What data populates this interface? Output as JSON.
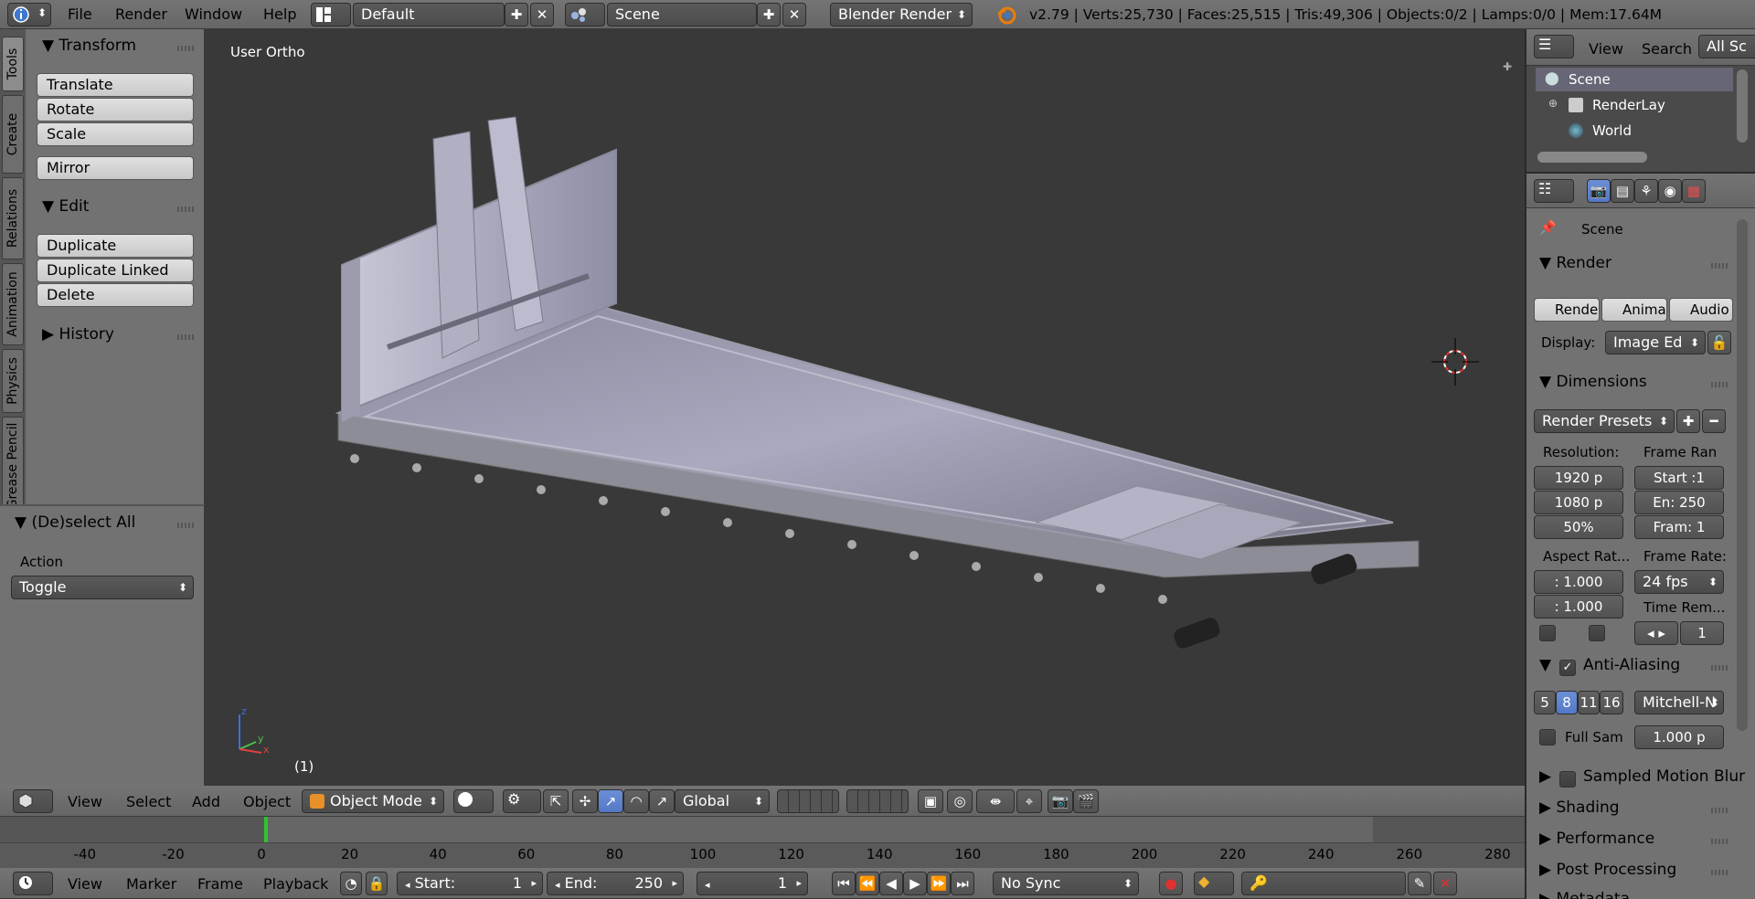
{
  "top": {
    "menus": [
      "File",
      "Render",
      "Window",
      "Help"
    ],
    "screen_layout": "Default",
    "scene": "Scene",
    "engine": "Blender Render",
    "stats": "v2.79 | Verts:25,730 | Faces:25,515 | Tris:49,306 | Objects:0/2 | Lamps:0/0 | Mem:17.64M"
  },
  "tabs": [
    "Tools",
    "Create",
    "Relations",
    "Animation",
    "Physics",
    "Grease Pencil"
  ],
  "toolshelf": {
    "transform_title": "Transform",
    "translate": "Translate",
    "rotate": "Rotate",
    "scale": "Scale",
    "mirror": "Mirror",
    "edit_title": "Edit",
    "duplicate": "Duplicate",
    "duplicate_linked": "Duplicate Linked",
    "delete": "Delete",
    "history_title": "History"
  },
  "operator": {
    "title": "(De)select All",
    "action_label": "Action",
    "action_value": "Toggle"
  },
  "viewport": {
    "view_name": "User Ortho",
    "frame_indicator": "(1)",
    "axis_labels": [
      "z",
      "y",
      "x"
    ]
  },
  "view3d_header": {
    "menus": [
      "View",
      "Select",
      "Add",
      "Object"
    ],
    "mode": "Object Mode",
    "orientation": "Global"
  },
  "timeline": {
    "ticks": [
      "-40",
      "-20",
      "0",
      "20",
      "40",
      "60",
      "80",
      "100",
      "120",
      "140",
      "160",
      "180",
      "200",
      "220",
      "240",
      "260",
      "280"
    ],
    "current_frame": 1,
    "menus": [
      "View",
      "Marker",
      "Frame",
      "Playback"
    ],
    "start_label": "Start:",
    "start_value": "1",
    "end_label": "End:",
    "end_value": "250",
    "frame_value": "1",
    "sync": "No Sync"
  },
  "outliner": {
    "menus": [
      "View",
      "Search"
    ],
    "filter": "All Sc",
    "items": [
      "Scene",
      "RenderLay",
      "World"
    ]
  },
  "properties": {
    "scene_path": "Scene",
    "render_title": "Render",
    "render_btns": [
      "Rende",
      "Anima",
      "Audio"
    ],
    "display_label": "Display:",
    "display_value": "Image Ed",
    "dimensions_title": "Dimensions",
    "presets": "Render Presets",
    "resolution_label": "Resolution:",
    "res_x": "1920 p",
    "res_y": "1080 p",
    "res_pct": "50%",
    "frame_range_label": "Frame Ran",
    "frame_start": "Start :1",
    "frame_end": "En: 250",
    "frame_step": "Fram: 1",
    "aspect_label": "Aspect Rat...",
    "aspect_x": ": 1.000",
    "aspect_y": ": 1.000",
    "frame_rate_label": "Frame Rate:",
    "frame_rate": "24 fps",
    "time_remap_label": "Time Rem...",
    "time_remap_value": "1",
    "aa_title": "Anti-Aliasing",
    "aa_samples": [
      "5",
      "8",
      "11",
      "16"
    ],
    "aa_selected": "8",
    "aa_filter": "Mitchell-N",
    "full_sample": "Full Sam",
    "filter_size": "1.000 p",
    "motion_blur": "Sampled Motion Blur",
    "shading": "Shading",
    "performance": "Performance",
    "post_processing": "Post Processing",
    "metadata": "Metadata"
  },
  "colors": {
    "accent_blue": "#5680c2",
    "frame_marker": "#2ec52e",
    "viewport_bg": "#393939"
  }
}
